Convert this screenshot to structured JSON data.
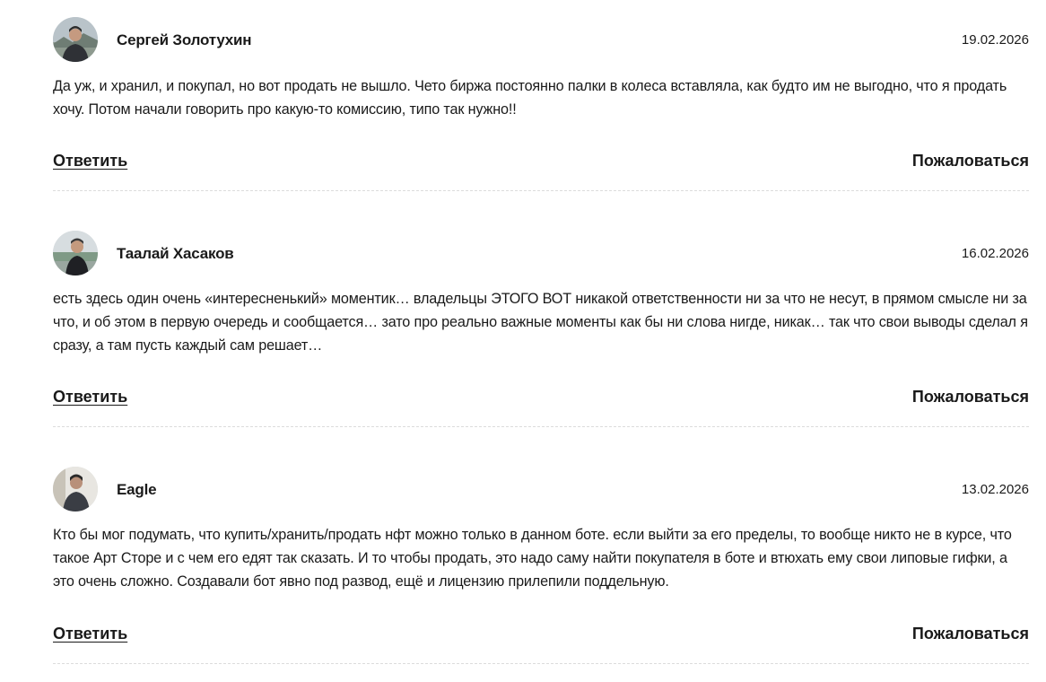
{
  "comments": [
    {
      "author": "Сергей Золотухин",
      "date": "19.02.2026",
      "avatar_icon": "user-photo-avatar",
      "text": "Да уж, и хранил, и покупал, но вот продать не вышло. Чето биржа постоянно палки в колеса вставляла, как будто им не выгодно, что я продать хочу. Потом начали говорить про какую-то комиссию, типо так нужно!!",
      "reply_label": "Ответить",
      "report_label": "Пожаловаться"
    },
    {
      "author": "Таалай Хасаков",
      "date": "16.02.2026",
      "avatar_icon": "user-photo-avatar",
      "text": "есть здесь один очень «интересненький» моментик… владельцы ЭТОГО ВОТ никакой ответственности ни за что не несут, в прямом смысле ни за что, и об этом в первую очередь и сообщается… зато про реально важные моменты как бы ни слова нигде, никак… так что свои выводы сделал я сразу, а там пусть каждый сам решает…",
      "reply_label": "Ответить",
      "report_label": "Пожаловаться"
    },
    {
      "author": "Eagle",
      "date": "13.02.2026",
      "avatar_icon": "user-photo-avatar",
      "text": "Кто бы мог подумать, что купить/хранить/продать нфт можно только в данном боте. если выйти за его пределы, то вообще никто не в курсе, что такое Арт Сторе и с чем его едят так сказать. И то чтобы продать, это надо саму найти покупателя в боте и втюхать ему свои липовые гифки, а это очень сложно. Создавали бот явно под развод, ещё и лицензию прилепили поддельную.",
      "reply_label": "Ответить",
      "report_label": "Пожаловаться"
    }
  ]
}
